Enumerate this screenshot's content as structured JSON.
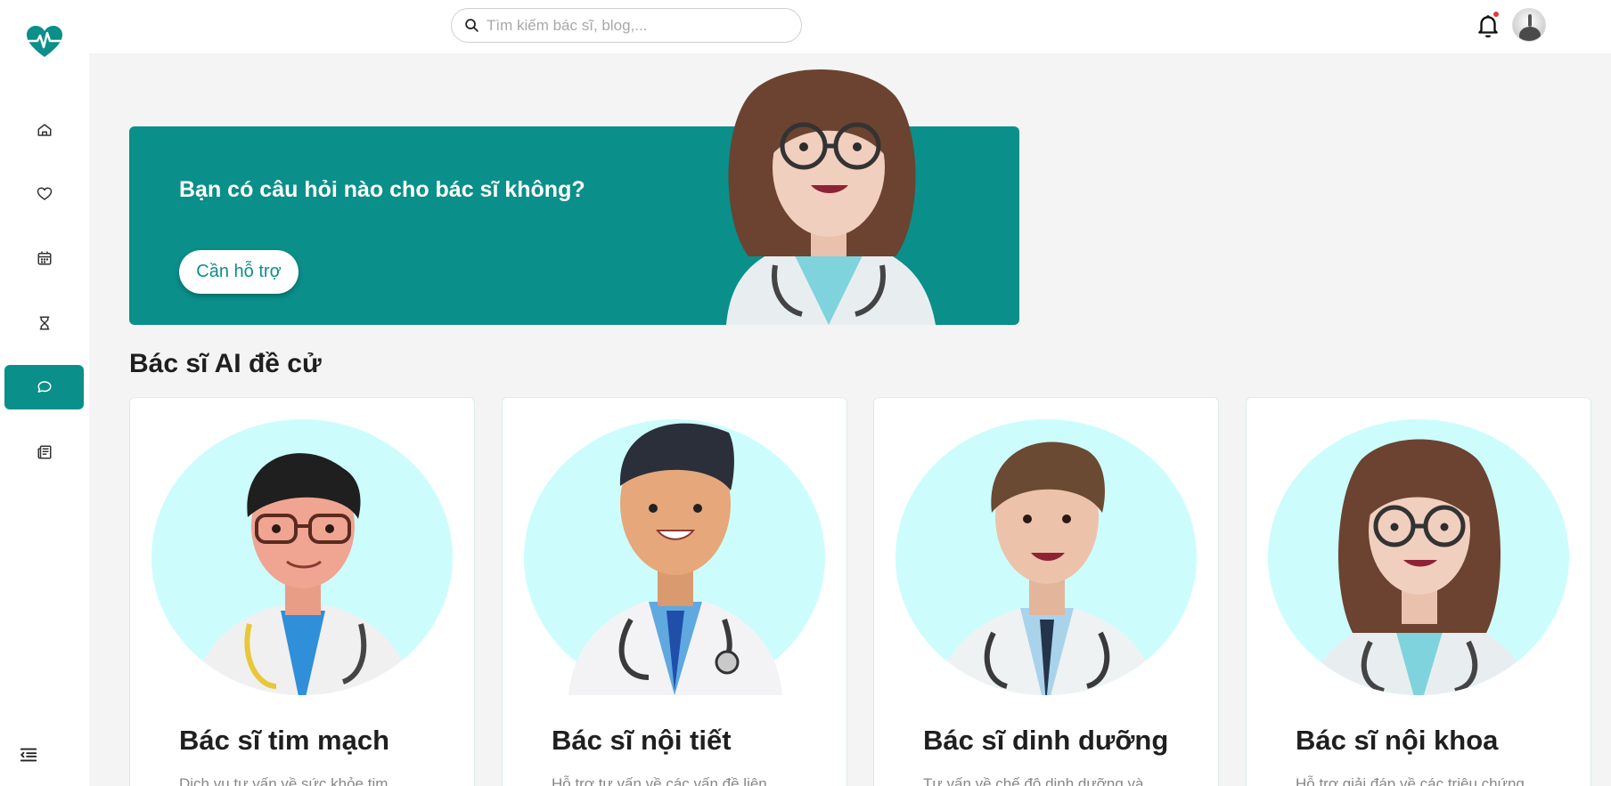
{
  "search": {
    "placeholder": "Tìm kiếm bác sĩ, blog,..."
  },
  "banner": {
    "title": "Bạn có câu hỏi nào cho bác sĩ không?",
    "button_label": "Cần hỗ trợ"
  },
  "section": {
    "title": "Bác sĩ AI đề cử"
  },
  "doctors": [
    {
      "title": "Bác sĩ tim mạch",
      "desc": "Dịch vụ tư vấn về sức khỏe tim"
    },
    {
      "title": "Bác sĩ nội tiết",
      "desc": "Hỗ trợ tư vấn về các vấn đề liên"
    },
    {
      "title": "Bác sĩ dinh dưỡng",
      "desc": "Tư vấn về chế độ dinh dưỡng và"
    },
    {
      "title": "Bác sĩ nội khoa",
      "desc": "Hỗ trợ giải đáp về các triệu chứng"
    }
  ],
  "icons": {
    "logo": "heart-pulse-icon",
    "nav": [
      "home-icon",
      "heart-icon",
      "calendar-icon",
      "hourglass-icon",
      "chat-icon",
      "newspaper-icon"
    ],
    "collapse": "menu-collapse-icon",
    "notification": "bell-icon",
    "search": "search-icon"
  },
  "colors": {
    "brand": "#0a8f8a",
    "portrait_bg": "#ccfdfc",
    "notification_dot": "#e53935"
  },
  "sidebar": {
    "active_index": 4
  }
}
